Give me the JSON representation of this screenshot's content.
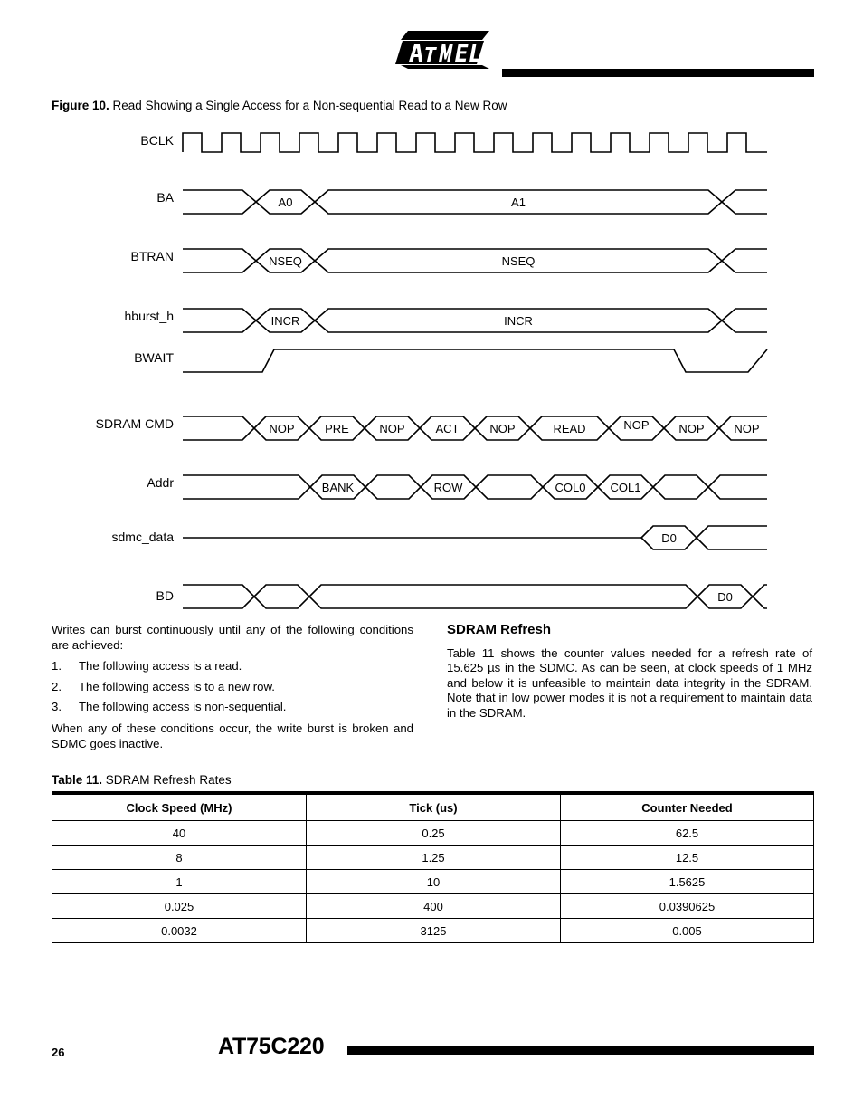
{
  "header": {
    "logo_name": "atmel-logo",
    "logo_text": "ATMEL"
  },
  "figure": {
    "label": "Figure 10.",
    "title": "Read Showing a Single Access for a Non-sequential Read to a New Row"
  },
  "timing_diagram": {
    "signals": [
      {
        "name": "BCLK",
        "type": "clock"
      },
      {
        "name": "BA",
        "type": "bus"
      },
      {
        "name": "BTRAN",
        "type": "bus"
      },
      {
        "name": "hburst_h",
        "type": "bus"
      },
      {
        "name": "BWAIT",
        "type": "level"
      },
      {
        "name": "SDRAM CMD",
        "type": "bus"
      },
      {
        "name": "Addr",
        "type": "bus"
      },
      {
        "name": "sdmc_data",
        "type": "bus"
      },
      {
        "name": "BD",
        "type": "bus"
      }
    ],
    "bclk_pulses": 15,
    "bus_values": {
      "BA": [
        "",
        "A0",
        "A1",
        ""
      ],
      "BTRAN": [
        "",
        "NSEQ",
        "NSEQ",
        ""
      ],
      "hburst_h": [
        "",
        "INCR",
        "INCR",
        ""
      ],
      "SDRAM_CMD": [
        "",
        "NOP",
        "PRE",
        "NOP",
        "ACT",
        "NOP",
        "READ",
        "NOP",
        "NOP",
        "NOP"
      ],
      "Addr": [
        "",
        "BANK",
        "",
        "ROW",
        "",
        "COL0",
        "COL1",
        "",
        ""
      ],
      "sdmc_data": [
        "",
        "D0",
        ""
      ],
      "BD": [
        "",
        "",
        "",
        "D0",
        ""
      ]
    }
  },
  "left_column": {
    "intro": "Writes can burst continuously until any of the following conditions are achieved:",
    "conditions": [
      {
        "num": "1.",
        "text": "The following access is a read."
      },
      {
        "num": "2.",
        "text": "The following access is to a new row."
      },
      {
        "num": "3.",
        "text": "The following access is non-sequential."
      }
    ],
    "outro": "When any of these conditions occur, the write burst is broken and SDMC goes inactive."
  },
  "right_column": {
    "heading": "SDRAM Refresh",
    "body": "Table 11 shows the counter values needed for a refresh rate of 15.625 µs in the SDMC. As can be seen, at clock speeds of 1 MHz and below it is unfeasible to maintain data integrity in the SDRAM. Note that in low power modes it is not a requirement to maintain data in the SDRAM."
  },
  "table": {
    "label": "Table 11.",
    "title": "SDRAM Refresh Rates",
    "headers": [
      "Clock Speed (MHz)",
      "Tick (us)",
      "Counter Needed"
    ],
    "rows": [
      [
        "40",
        "0.25",
        "62.5"
      ],
      [
        "8",
        "1.25",
        "12.5"
      ],
      [
        "1",
        "10",
        "1.5625"
      ],
      [
        "0.025",
        "400",
        "0.0390625"
      ],
      [
        "0.0032",
        "3125",
        "0.005"
      ]
    ]
  },
  "footer": {
    "page_number": "26",
    "part_number": "AT75C220"
  }
}
